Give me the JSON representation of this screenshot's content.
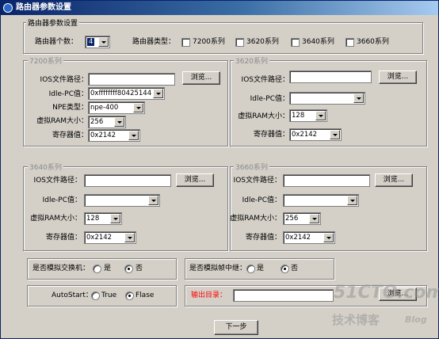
{
  "window": {
    "title": "路由器参数设置"
  },
  "main_group": {
    "legend": "路由器参数设置"
  },
  "router_count": {
    "label": "路由器个数：",
    "value": "4"
  },
  "router_type": {
    "label": "路由器类型：",
    "options": [
      {
        "label": "7200系列",
        "checked": false
      },
      {
        "label": "3620系列",
        "checked": false
      },
      {
        "label": "3640系列",
        "checked": false
      },
      {
        "label": "3660系列",
        "checked": false
      }
    ]
  },
  "panel_7200": {
    "legend": "7200系列",
    "ios_label": "IOS文件路径：",
    "ios_value": "",
    "browse": "浏览...",
    "idle_label": "Idle-PC值：",
    "idle_value": "0xffffffff80425144",
    "npe_label": "NPE类型：",
    "npe_value": "npe-400",
    "ram_label": "虚拟RAM大小：",
    "ram_value": "256",
    "reg_label": "寄存器值：",
    "reg_value": "0x2142"
  },
  "panel_3620": {
    "legend": "3620系列",
    "ios_label": "IOS文件路径：",
    "ios_value": "",
    "browse": "浏览...",
    "idle_label": "Idle-PC值：",
    "idle_value": "",
    "ram_label": "虚拟RAM大小：",
    "ram_value": "128",
    "reg_label": "寄存器值：",
    "reg_value": "0x2142"
  },
  "panel_3640": {
    "legend": "3640系列",
    "ios_label": "IOS文件路径：",
    "ios_value": "",
    "browse": "浏览...",
    "idle_label": "Idle-PC值：",
    "idle_value": "",
    "ram_label": "虚拟RAM大小：",
    "ram_value": "128",
    "reg_label": "寄存器值：",
    "reg_value": "0x2142"
  },
  "panel_3660": {
    "legend": "3660系列",
    "ios_label": "IOS文件路径：",
    "ios_value": "",
    "browse": "浏览...",
    "idle_label": "Idle-PC值：",
    "idle_value": "",
    "ram_label": "虚拟RAM大小：",
    "ram_value": "256",
    "reg_label": "寄存器值：",
    "reg_value": "0x2142"
  },
  "switch_sim": {
    "label": "是否模拟交换机：",
    "yes": "是",
    "no": "否",
    "selected": "no"
  },
  "framerelay_sim": {
    "label": "是否模拟帧中继：",
    "yes": "是",
    "no": "否",
    "selected": "no"
  },
  "autostart": {
    "label": "AutoStart：",
    "true_label": "True",
    "false_label": "Flase",
    "selected": "false"
  },
  "output_dir": {
    "label": "输出目录：",
    "value": "",
    "browse": "浏览..."
  },
  "next_button": "下一步",
  "watermark": {
    "line1": "51CTO.com",
    "line2": "技术博客",
    "line3": "Blog"
  },
  "colors": {
    "title_start": "#0a246a",
    "title_end": "#a6caf0",
    "face": "#d4d0c8",
    "output_label": "#ff0000"
  }
}
